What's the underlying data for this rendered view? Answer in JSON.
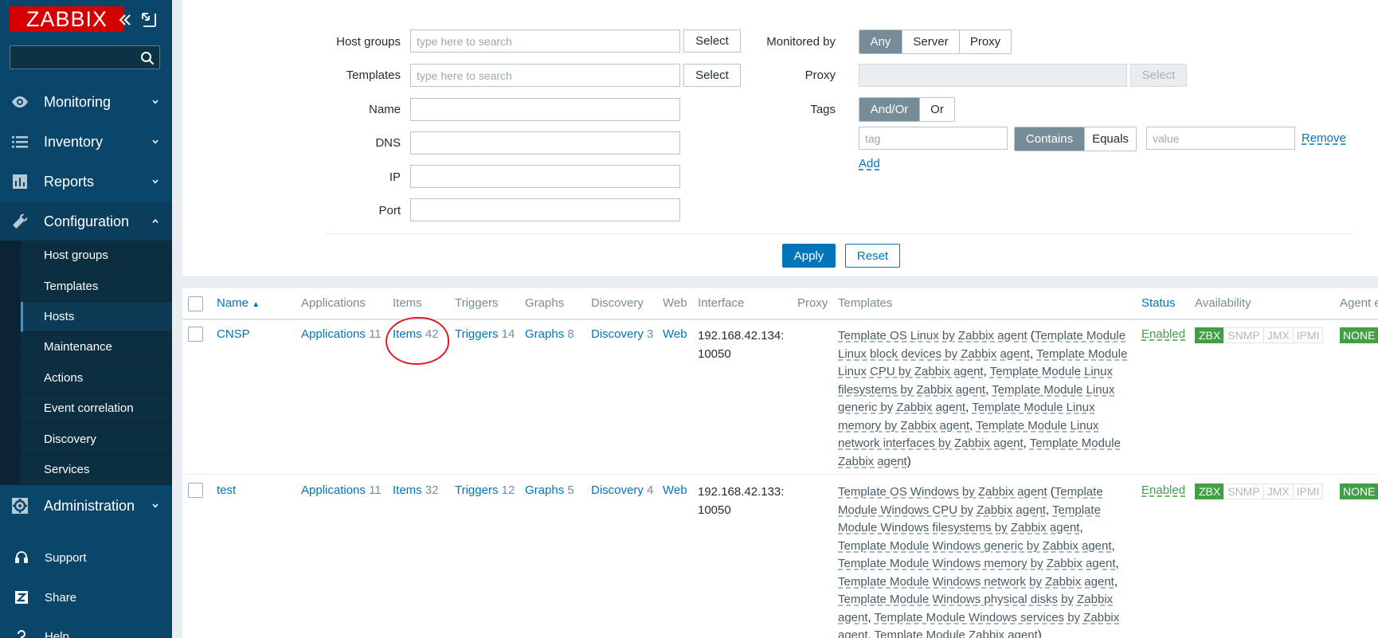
{
  "sidebar": {
    "logo": "ZABBIX",
    "search_placeholder": "",
    "menu": [
      {
        "label": "Monitoring",
        "icon": "eye-icon"
      },
      {
        "label": "Inventory",
        "icon": "list-icon"
      },
      {
        "label": "Reports",
        "icon": "bar-chart-icon"
      },
      {
        "label": "Configuration",
        "icon": "wrench-icon"
      },
      {
        "label": "Administration",
        "icon": "gear-icon"
      }
    ],
    "submenu": [
      "Host groups",
      "Templates",
      "Hosts",
      "Maintenance",
      "Actions",
      "Event correlation",
      "Discovery",
      "Services"
    ],
    "active_submenu": "Hosts",
    "bottom": [
      {
        "label": "Support",
        "icon": "headset-icon"
      },
      {
        "label": "Share",
        "icon": "share-z-icon"
      },
      {
        "label": "Help",
        "icon": "help-icon"
      }
    ]
  },
  "filter": {
    "host_groups_label": "Host groups",
    "templates_label": "Templates",
    "name_label": "Name",
    "dns_label": "DNS",
    "ip_label": "IP",
    "port_label": "Port",
    "search_placeholder": "type here to search",
    "select_label": "Select",
    "monitored_by_label": "Monitored by",
    "monitored_by_options": [
      "Any",
      "Server",
      "Proxy"
    ],
    "proxy_label": "Proxy",
    "tags_label": "Tags",
    "tags_options": [
      "And/Or",
      "Or"
    ],
    "tag_placeholder": "tag",
    "tag_operators": [
      "Contains",
      "Equals"
    ],
    "value_placeholder": "value",
    "remove_label": "Remove",
    "add_label": "Add",
    "apply_label": "Apply",
    "reset_label": "Reset"
  },
  "table": {
    "headers": {
      "name": "Name",
      "applications": "Applications",
      "items": "Items",
      "triggers": "Triggers",
      "graphs": "Graphs",
      "discovery": "Discovery",
      "web": "Web",
      "interface": "Interface",
      "proxy": "Proxy",
      "templates": "Templates",
      "status": "Status",
      "availability": "Availability",
      "agent_encryption": "Agent e"
    },
    "rows": [
      {
        "name": "CNSP",
        "applications": "Applications",
        "applications_count": "11",
        "items": "Items",
        "items_count": "42",
        "triggers": "Triggers",
        "triggers_count": "14",
        "graphs": "Graphs",
        "graphs_count": "8",
        "discovery": "Discovery",
        "discovery_count": "3",
        "web": "Web",
        "interface_1": "192.168.42.134:",
        "interface_2": "10050",
        "template_main": "Template OS Linux by Zabbix agent",
        "template_children": [
          "Template Module Linux block devices by Zabbix agent",
          "Template Module Linux CPU by Zabbix agent",
          "Template Module Linux filesystems by Zabbix agent",
          "Template Module Linux generic by Zabbix agent",
          "Template Module Linux memory by Zabbix agent",
          "Template Module Linux network interfaces by Zabbix agent",
          "Template Module Zabbix agent"
        ],
        "status": "Enabled",
        "availability": [
          "ZBX",
          "SNMP",
          "JMX",
          "IPMI"
        ],
        "encryption": "NONE"
      },
      {
        "name": "test",
        "applications": "Applications",
        "applications_count": "11",
        "items": "Items",
        "items_count": "32",
        "triggers": "Triggers",
        "triggers_count": "12",
        "graphs": "Graphs",
        "graphs_count": "5",
        "discovery": "Discovery",
        "discovery_count": "4",
        "web": "Web",
        "interface_1": "192.168.42.133:",
        "interface_2": "10050",
        "template_main": "Template OS Windows by Zabbix agent",
        "template_children": [
          "Template Module Windows CPU by Zabbix agent",
          "Template Module Windows filesystems by Zabbix agent",
          "Template Module Windows generic by Zabbix agent",
          "Template Module Windows memory by Zabbix agent",
          "Template Module Windows network by Zabbix agent",
          "Template Module Windows physical disks by Zabbix agent",
          "Template Module Windows services by Zabbix agent",
          "Template Module Zabbix agent"
        ],
        "status": "Enabled",
        "availability": [
          "ZBX",
          "SNMP",
          "JMX",
          "IPMI"
        ],
        "encryption": "NONE"
      }
    ]
  },
  "colors": {
    "sidebar": "#0a466a",
    "accent": "#0275b8",
    "brand": "#d40000",
    "enabled": "#429e47",
    "annotation": "#e01b24"
  }
}
